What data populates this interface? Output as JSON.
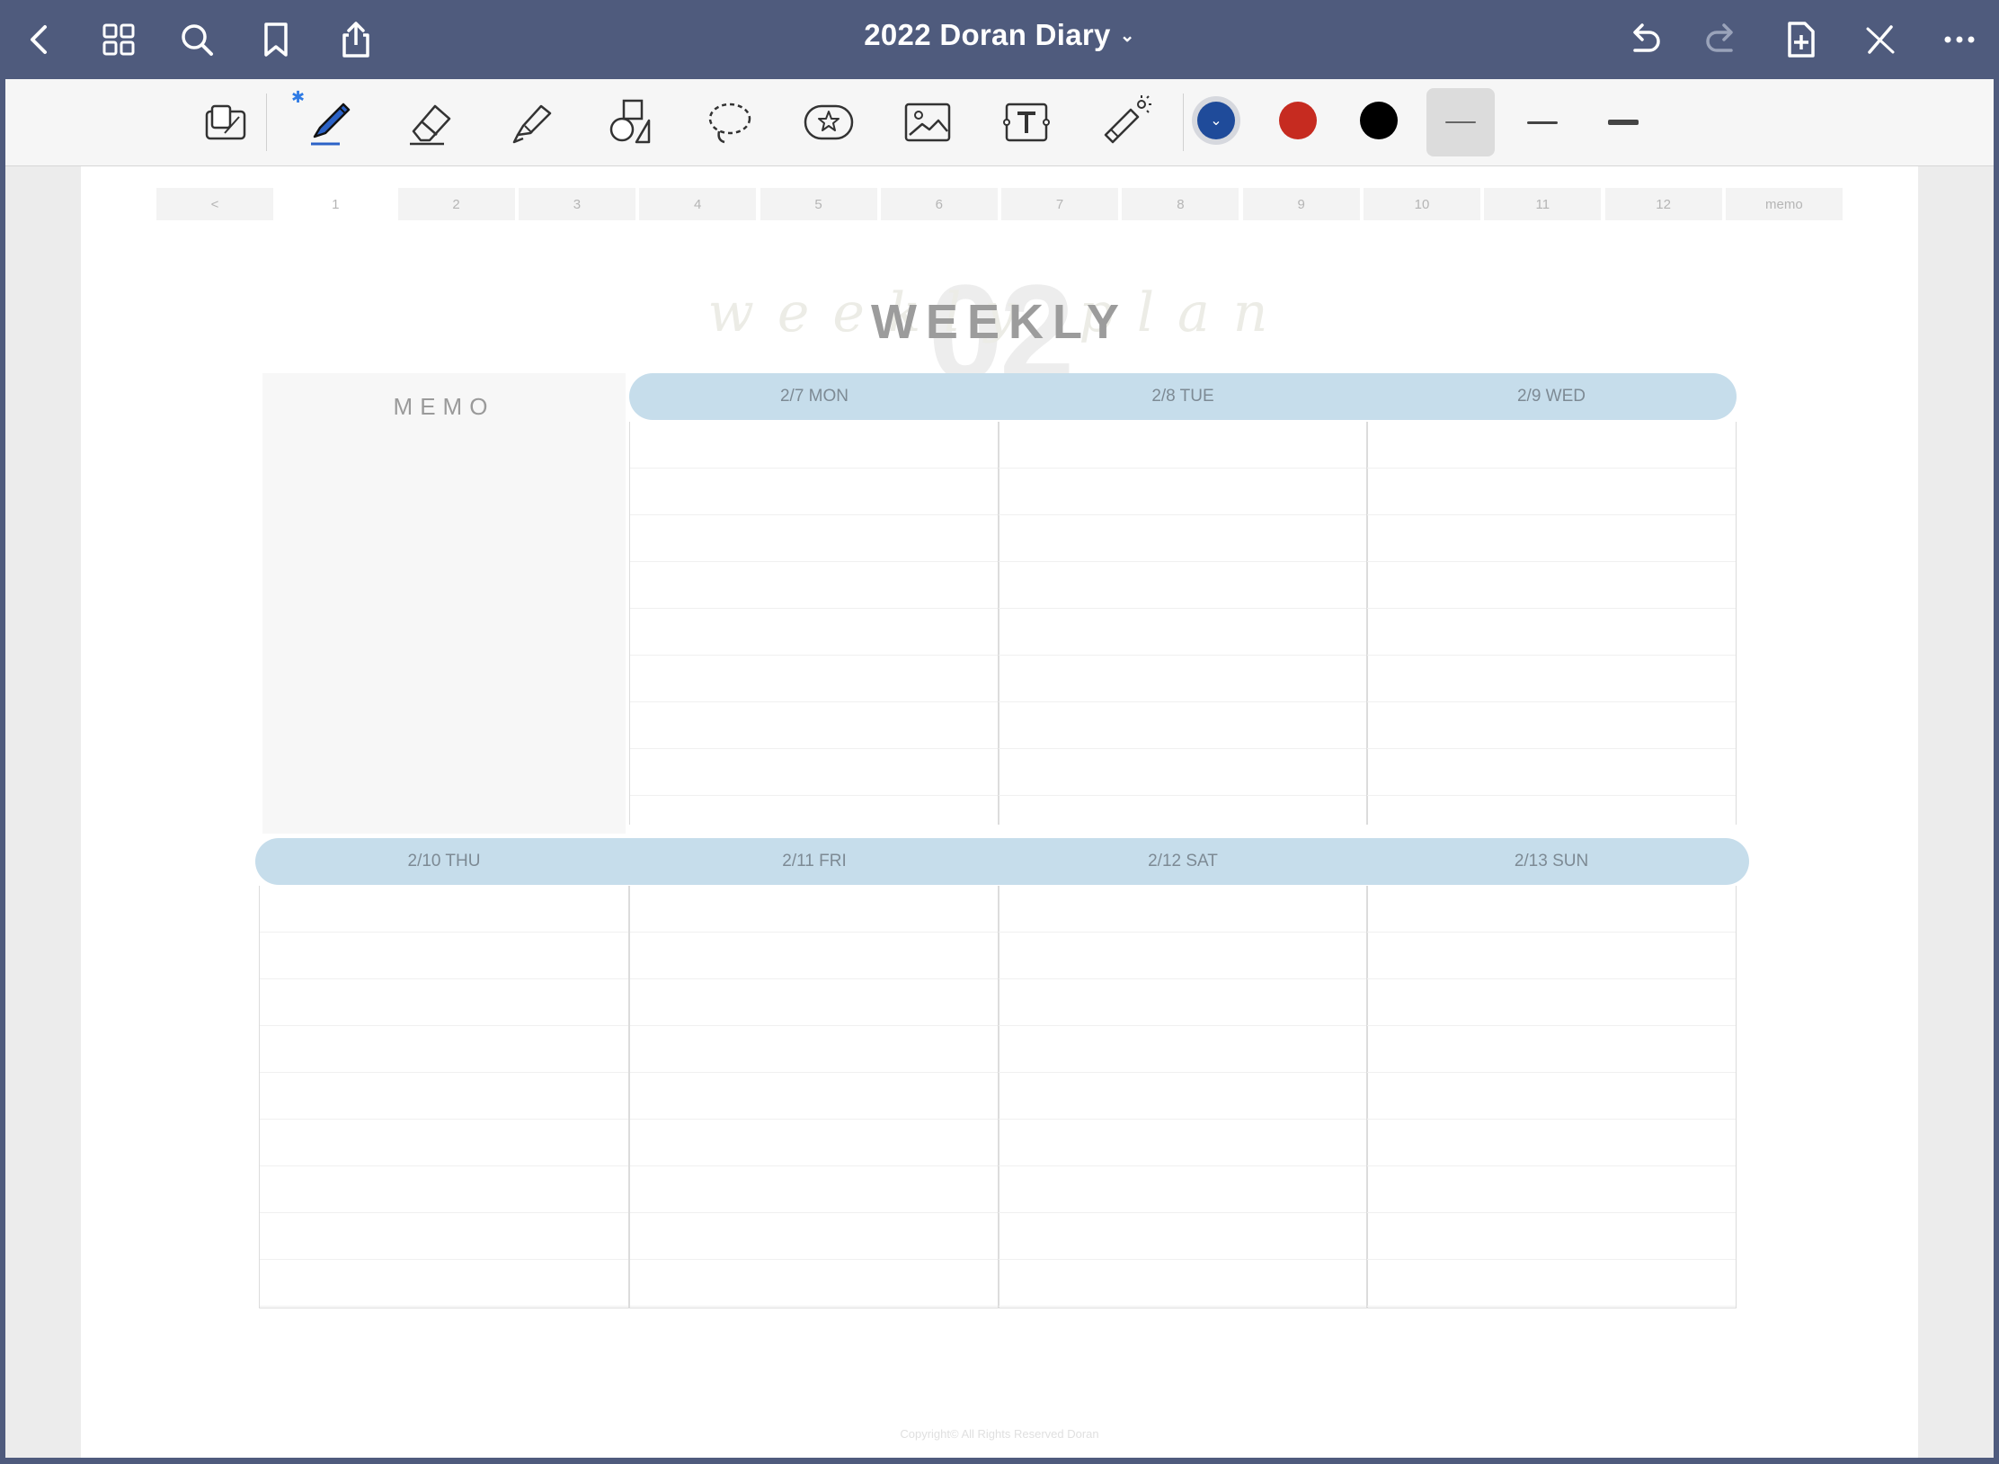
{
  "header": {
    "title": "2022 Doran Diary",
    "title_chevron": "⌄",
    "buttons": [
      "back-icon",
      "grid-icon",
      "search-icon",
      "bookmark-icon",
      "share-icon",
      "undo-icon",
      "redo-icon",
      "add-page-icon",
      "edit-off-icon",
      "more-icon"
    ]
  },
  "toolbar": {
    "bluetooth_glyph": "✱",
    "tools": [
      "zoom-window-icon",
      "pen-icon",
      "eraser-icon",
      "highlighter-icon",
      "shapes-icon",
      "lasso-icon",
      "sticker-icon",
      "image-icon",
      "text-icon",
      "laser-pointer-icon"
    ],
    "selected_tool": "pen",
    "colors": [
      "#1f4b9a",
      "#c62b20",
      "#000000"
    ],
    "selected_color": "#1f4b9a",
    "selected_color_chevron": "⌄",
    "selected_thickness": 0
  },
  "page": {
    "tabs": [
      "<",
      "1",
      "2",
      "3",
      "4",
      "5",
      "6",
      "7",
      "8",
      "9",
      "10",
      "11",
      "12",
      "memo"
    ],
    "active_tab": "1",
    "week_number": "02",
    "script_text": "weekly plan",
    "heading": "WEEKLY",
    "memo_label": "MEMO",
    "days_top": [
      "2/7 MON",
      "2/8 TUE",
      "2/9 WED"
    ],
    "days_bottom": [
      "2/10 THU",
      "2/11 FRI",
      "2/12 SAT",
      "2/13 SUN"
    ],
    "footer": "Copyright© All Rights Reserved Doran",
    "colors": {
      "band": "#c6ddeb",
      "chrome": "#4f5b7d"
    }
  }
}
